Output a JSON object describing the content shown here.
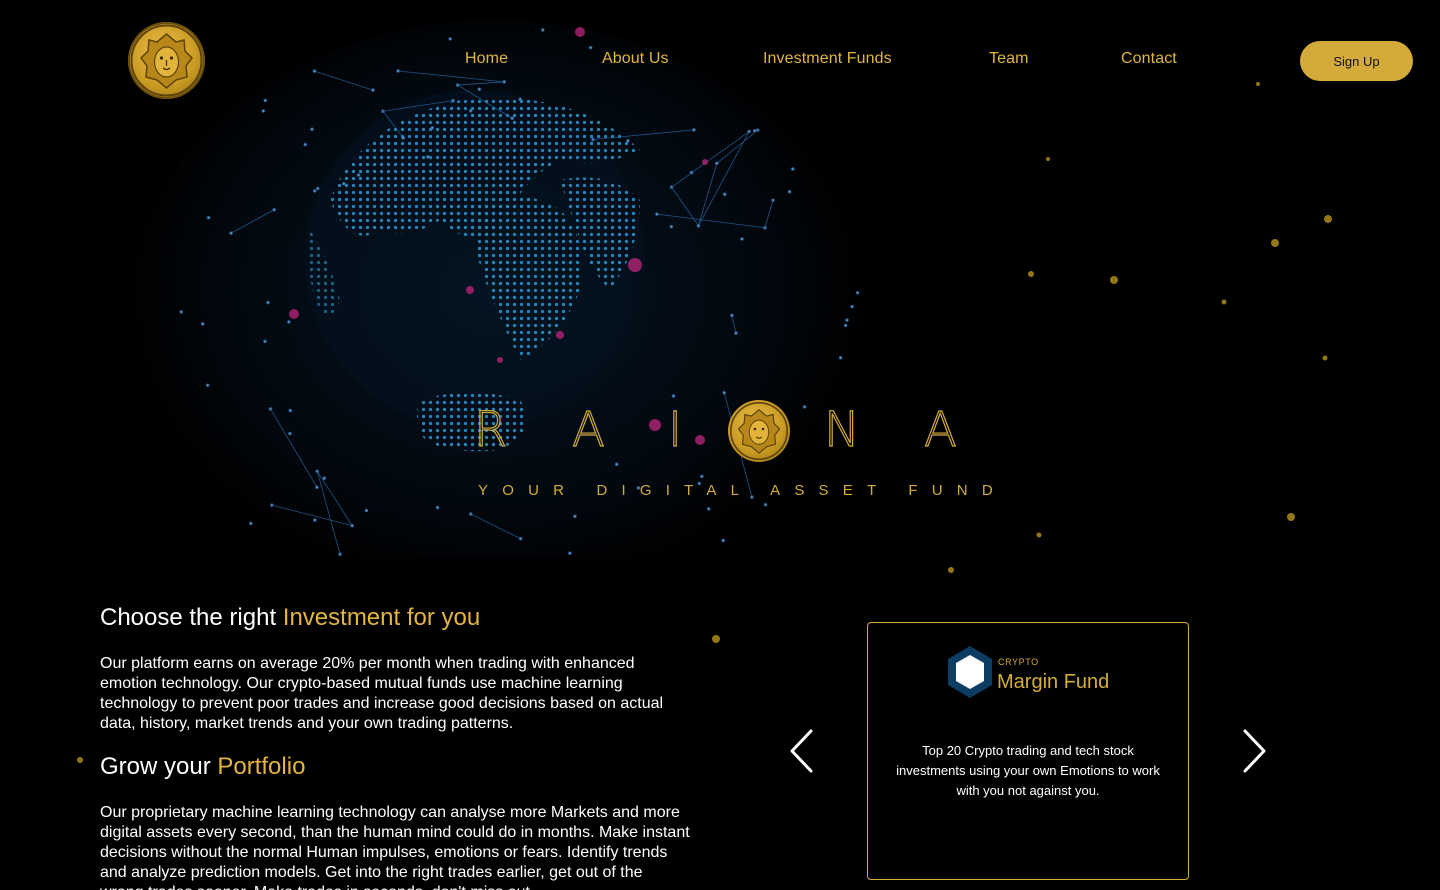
{
  "brand": {
    "logo_icon": "lion-emblem-icon",
    "accent_color": "#d4ab3b"
  },
  "nav": {
    "items": [
      {
        "label": "Home"
      },
      {
        "label": "About Us"
      },
      {
        "label": "Investment Funds"
      },
      {
        "label": "Team"
      },
      {
        "label": "Contact"
      }
    ],
    "signup_label": "Sign Up"
  },
  "hero": {
    "letters": [
      "R",
      "A",
      "I",
      "N",
      "A"
    ],
    "emblem_icon": "lion-emblem-icon",
    "tagline": "YOUR DIGITAL ASSET FUND",
    "background_icon": "network-globe-icon"
  },
  "section1": {
    "heading_plain": "Choose the right ",
    "heading_accent": "Investment for you",
    "body": "Our platform earns on average 20% per month when trading with enhanced emotion technology. Our crypto-based mutual funds use machine learning technology to prevent poor trades and increase good decisions based on actual data, history, market trends and your own trading patterns."
  },
  "section2": {
    "heading_plain": "Grow your ",
    "heading_accent": "Portfolio",
    "body": "Our proprietary machine learning technology can analyse more Markets and more digital assets every second, than the human mind could do in months. Make instant decisions without the normal Human impulses, emotions or fears. Identify trends and analyze prediction models. Get into the right trades earlier, get out of the wrong trades sooner. Make trades in seconds, don't miss out."
  },
  "fund_card": {
    "icon": "hexagon-icon",
    "kicker": "CRYPTO",
    "title": "Margin Fund",
    "description": "Top 20 Crypto trading and tech stock investments using your own Emotions to work with you not against you.",
    "prev_icon": "chevron-left-icon",
    "next_icon": "chevron-right-icon"
  }
}
